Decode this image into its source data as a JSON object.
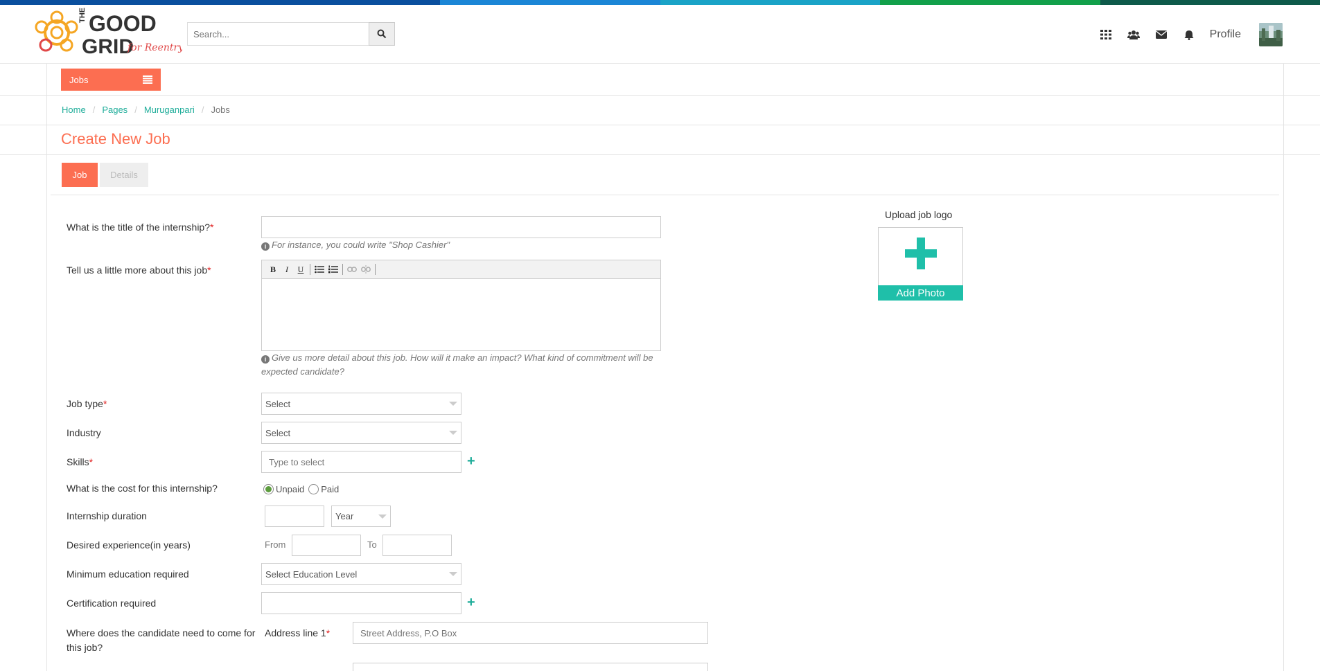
{
  "brand": {
    "logo_word1": "THE",
    "logo_word2": "GOOD",
    "logo_word3": "GRID",
    "logo_tagline": "for Reentry",
    "stripe_colors": [
      "#0a4f9e",
      "#0a4f9e",
      "#1b86d6",
      "#1aa3c7",
      "#12a04a",
      "#0e5a4a"
    ]
  },
  "search": {
    "placeholder": "Search..."
  },
  "topnav": {
    "icons": [
      "grid-icon",
      "users-icon",
      "envelope-icon",
      "bell-icon"
    ],
    "profile_label": "Profile"
  },
  "jobs_menu": {
    "label": "Jobs"
  },
  "breadcrumb": {
    "home": "Home",
    "pages": "Pages",
    "page": "Muruganpari",
    "current": "Jobs"
  },
  "page_title": "Create New Job",
  "tabs": {
    "job": "Job",
    "details": "Details"
  },
  "form": {
    "title_label": "What is the title of the internship?",
    "title_hint": "For instance, you could write \"Shop Cashier\"",
    "about_label": "Tell us a little more about this job",
    "about_hint": "Give us more detail about this job. How will it make an impact? What kind of commitment will be expected candidate?",
    "job_type_label": "Job type",
    "job_type_value": "Select",
    "industry_label": "Industry",
    "industry_value": "Select",
    "skills_label": "Skills",
    "skills_placeholder": "Type to select",
    "cost_label": "What is the cost for this internship?",
    "cost_unpaid": "Unpaid",
    "cost_paid": "Paid",
    "duration_label": "Internship duration",
    "duration_unit": "Year",
    "experience_label": "Desired experience(in years)",
    "experience_from": "From",
    "experience_to": "To",
    "education_label": "Minimum education required",
    "education_value": "Select Education Level",
    "certification_label": "Certification required",
    "location_label": "Where does the candidate need to come for this job?",
    "address1_label": "Address line 1",
    "address1_placeholder": "Street Address, P.O Box",
    "required_mark": "*"
  },
  "upload": {
    "title": "Upload job logo",
    "button": "Add Photo"
  },
  "colors": {
    "accent": "#fc6e51",
    "teal": "#1fbfa9",
    "link": "#1fad9a"
  }
}
